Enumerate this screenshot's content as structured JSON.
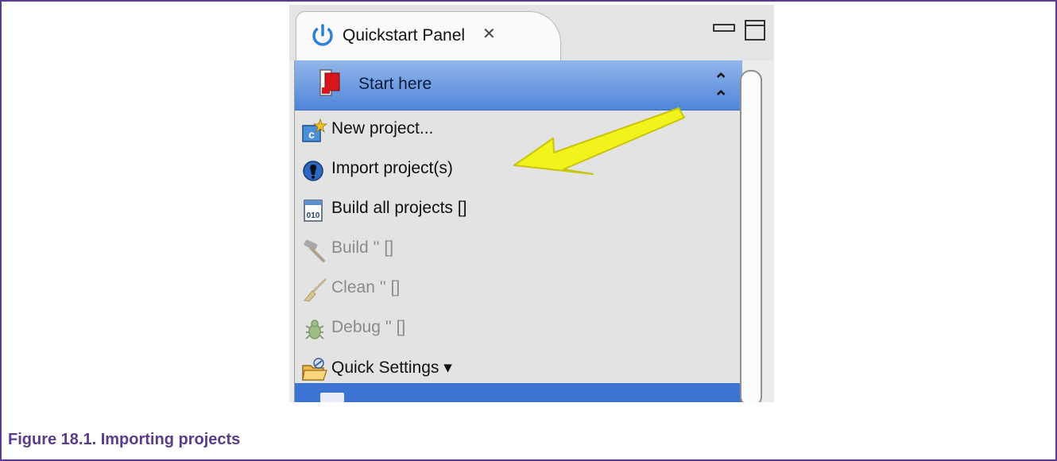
{
  "tab": {
    "title": "Quickstart Panel",
    "icon": "power-icon",
    "close_icon": "close-tab-icon"
  },
  "view_controls": {
    "minimize_icon": "minimize-icon",
    "maximize_icon": "maximize-icon"
  },
  "section": {
    "title": "Start here",
    "icon": "start-here-icon",
    "collapse_icon": "collapse-icon"
  },
  "items": [
    {
      "label": "New project...",
      "icon": "new-project-icon",
      "enabled": true
    },
    {
      "label": "Import project(s)",
      "icon": "import-project-icon",
      "enabled": true
    },
    {
      "label": "Build all projects []",
      "icon": "build-all-icon",
      "enabled": true
    },
    {
      "label": "Build '' []",
      "icon": "hammer-icon",
      "enabled": false
    },
    {
      "label": "Clean '' []",
      "icon": "broom-icon",
      "enabled": false
    },
    {
      "label": "Debug '' []",
      "icon": "bug-icon",
      "enabled": false
    },
    {
      "label": "Quick Settings ▾",
      "icon": "quick-settings-icon",
      "enabled": true
    }
  ],
  "caption": "Figure 18.1. Importing projects",
  "colors": {
    "header_blue": "#4f86d9",
    "arrow_yellow": "#f2f21c",
    "caption_purple": "#5a3b8c"
  }
}
